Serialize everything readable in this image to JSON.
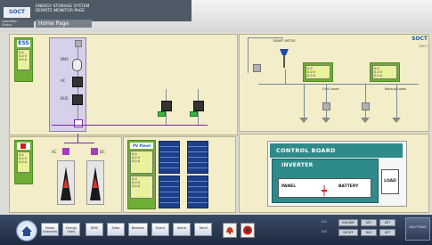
{
  "header": {
    "logo": "SOCT",
    "system_title_line1": "ENERGY STORAGE SYSTEM",
    "system_title_line2": "REMOTE MONITOR PAGE",
    "side_label_1": "Operation",
    "side_label_2": "Status",
    "page_tab": "Home Page"
  },
  "right_logo": "SOCT",
  "right_logo_sub": "SOCT",
  "left_panel": {
    "ess_logo": "ESS",
    "card_values": [
      "0.0",
      "0.0 V",
      "0.0 A"
    ],
    "node_labels": [
      "BMS",
      "AC",
      "BUS"
    ]
  },
  "bottom_left_panel": {
    "card_values": [
      "0.0",
      "0.0 V",
      "0.0 A"
    ],
    "node_labels": [
      "AC",
      "DC"
    ]
  },
  "pv_panel": {
    "logo": "PV Panel",
    "card_values": [
      "0.0",
      "0.0 V",
      "0.0 A",
      "0.0",
      "0.0 V",
      "0.0 A"
    ]
  },
  "right_panel": {
    "meter_label": "SMART METER",
    "labels": [
      "Grid Loads",
      "Backup Loads"
    ],
    "display1": [
      "0.0",
      "0.0 V",
      "0.0 A"
    ],
    "display2": [
      "0.0",
      "0.0 V",
      "0.0 A"
    ]
  },
  "control_board": {
    "title": "CONTROL BOARD",
    "inverter": "INVERTER",
    "panel": "PANEL",
    "battery": "BATTERY",
    "load": "LOAD"
  },
  "footer": {
    "nav_buttons": [
      "Home Overview",
      "Energy Stats",
      "BMS",
      "Solar",
      "Network",
      "Event",
      "Alarm",
      "Trend"
    ],
    "right_buttons_row1": [
      "ENGINE",
      "SET",
      "SET"
    ],
    "right_buttons_row2": [
      "NIGHT",
      "DAY",
      "SET"
    ],
    "small_labels": [
      "LV1",
      "LV2"
    ],
    "end_button": "HELP PAGE"
  },
  "colors": {
    "panel_bg": "#f3edc9",
    "green": "#6fae35",
    "header_dark": "#4e5a66",
    "footer_bg": "#1e2a40",
    "control_board_teal": "#2f8a8a"
  }
}
